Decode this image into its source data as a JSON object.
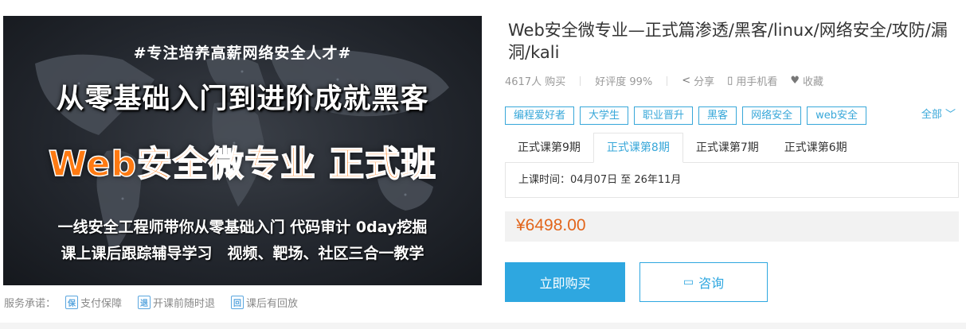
{
  "banner": {
    "hashtag": "#专注培养高薪网络安全人才#",
    "headline": "从零基础入门到进阶成就黑客",
    "course_title": "Web安全微专业 正式班",
    "tagline_1": "一线安全工程师带你从零基础入门 代码审计 0day挖掘",
    "tagline_2": "课上课后跟踪辅导学习　视频、靶场、社区三合一教学"
  },
  "promises": {
    "label": "服务承诺：",
    "items": [
      {
        "icon": "保",
        "label": "支付保障"
      },
      {
        "icon": "退",
        "label": "开课前随时退"
      },
      {
        "icon": "回",
        "label": "课后有回放"
      }
    ]
  },
  "course": {
    "title": "Web安全微专业—正式篇渗透/黑客/linux/网络安全/攻防/漏洞/kali",
    "buyers": "4617人 购买",
    "rating": "好评度 99%",
    "share": "分享",
    "mobile": "用手机看",
    "favorite": "收藏"
  },
  "tags": [
    "编程爱好者",
    "大学生",
    "职业晋升",
    "黑客",
    "网络安全",
    "web安全"
  ],
  "all_label": "全部",
  "periods": [
    {
      "label": "正式课第9期",
      "active": false
    },
    {
      "label": "正式课第8期",
      "active": true
    },
    {
      "label": "正式课第7期",
      "active": false
    },
    {
      "label": "正式课第6期",
      "active": false
    }
  ],
  "schedule": "上课时间：04月07日 至 26年11月",
  "price": "¥6498.00",
  "buttons": {
    "buy": "立即购买",
    "consult": "咨询"
  },
  "colors": {
    "accent": "#2ea7e0",
    "price": "#e2651b",
    "banner_title": "#ff7a12"
  }
}
